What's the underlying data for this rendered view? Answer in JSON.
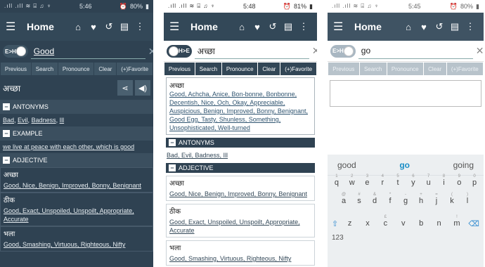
{
  "phones": [
    {
      "status": {
        "left": ".ıll .ıll ≋ ⌸ ♫ ♆",
        "time": "5:46",
        "battery": "80%"
      },
      "appbar": {
        "title": "Home"
      },
      "search": {
        "toggle": "E>H",
        "value": "Good"
      },
      "buttons": [
        "Previous",
        "Search",
        "Pronounce",
        "Clear",
        "(+)Favorite"
      ],
      "word": "अच्छा",
      "sections": [
        {
          "heading": "ANTONYMS",
          "items": [
            "Bad",
            "Evil",
            "Badness",
            "Ill"
          ]
        },
        {
          "heading": "EXAMPLE",
          "items": [
            "we live at peace with each other, which is good"
          ]
        },
        {
          "heading": "ADJECTIVE",
          "items": []
        }
      ],
      "adjective_entries": [
        {
          "word": "अच्छा",
          "links": "Good, Nice, Benign, Improved, Bonny, Benignant"
        },
        {
          "word": "ठीक",
          "links": "Good, Exact, Unspoiled, Unspoilt, Appropriate, Accurate"
        },
        {
          "word": "भला",
          "links": "Good, Smashing, Virtuous, Righteous, Nifty"
        }
      ]
    },
    {
      "status": {
        "left": ".ıll .ıll ≋ ⌸ ♫ ♆",
        "time": "5:48",
        "battery": "81%"
      },
      "appbar": {
        "title": "Home"
      },
      "search": {
        "toggle": "H>E",
        "value": "अच्छा"
      },
      "buttons": [
        "Previous",
        "Search",
        "Pronounce",
        "Clear",
        "(+)Favorite"
      ],
      "meaning": {
        "word": "अच्छा",
        "links": "Good, Achcha, Anice, Bon-bonne, Bonbonne, Decentish, Nice, Och, Okay, Appreciable, Auspicious, Benign, Improved, Bonny, Benignant, Good Egg, Tasty, Shunless, Something, Unsophisticated, Well-turned"
      },
      "sections": [
        {
          "heading": "ANTONYMS",
          "links": "Bad, Evil, Badness, Ill"
        },
        {
          "heading": "ADJECTIVE",
          "links": ""
        }
      ],
      "adjective_entries": [
        {
          "word": "अच्छा",
          "links": "Good, Nice, Benign, Improved, Bonny, Benignant"
        },
        {
          "word": "ठीक",
          "links": "Good, Exact, Unspoiled, Unspoilt, Appropriate, Accurate"
        },
        {
          "word": "भला",
          "links": "Good, Smashing, Virtuous, Righteous, Nifty"
        }
      ]
    },
    {
      "status": {
        "left": ".ıll .ıll ≋ ⌸ ♫ ♆",
        "time": "5:45",
        "battery": "80%"
      },
      "appbar": {
        "title": "Home"
      },
      "search": {
        "toggle": "E>H",
        "value": "go"
      },
      "buttons": [
        "Previous",
        "Search",
        "Pronounce",
        "Clear",
        "(+)Favorite"
      ],
      "keyboard": {
        "suggestions": [
          "good",
          "go",
          "going"
        ],
        "row1": [
          "q",
          "w",
          "e",
          "r",
          "t",
          "y",
          "u",
          "i",
          "o",
          "p"
        ],
        "row1_sub": [
          "1",
          "2",
          "3",
          "4",
          "5",
          "6",
          "7",
          "8",
          "9",
          "0"
        ],
        "row2": [
          "a",
          "s",
          "d",
          "f",
          "g",
          "h",
          "j",
          "k",
          "l"
        ],
        "row2_sub": [
          "@",
          "#",
          "&",
          "*",
          "-",
          "+",
          "=",
          "(",
          ")"
        ],
        "row3": [
          "z",
          "x",
          "c",
          "v",
          "b",
          "n",
          "m"
        ],
        "row3_sub": [
          "",
          "",
          "£",
          "",
          "",
          "",
          "!"
        ],
        "key123": "123"
      }
    }
  ]
}
